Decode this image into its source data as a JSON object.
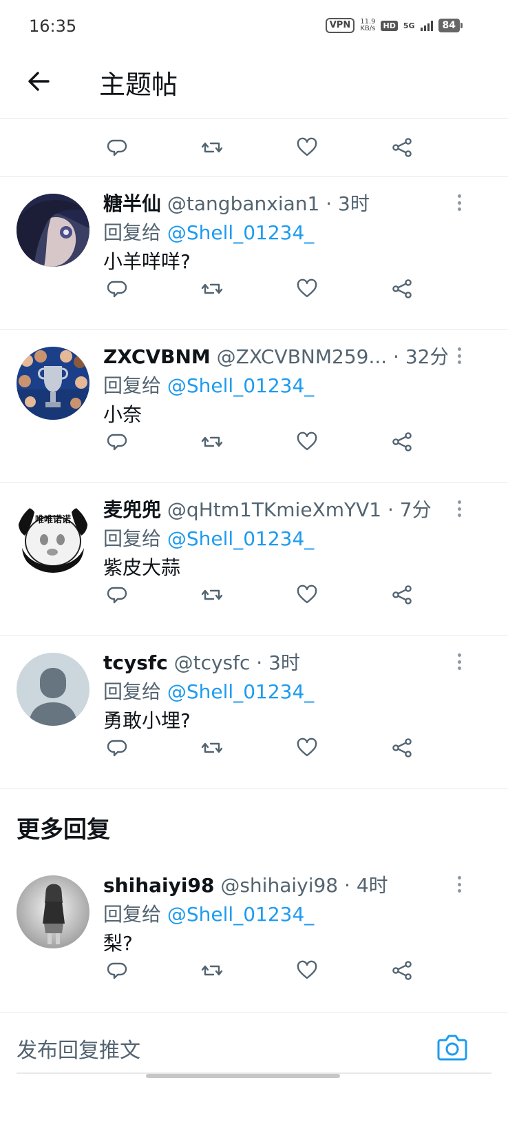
{
  "status_bar": {
    "time": "16:35",
    "vpn": "VPN",
    "speed_value": "11.9",
    "speed_unit": "KB/s",
    "hd": "HD",
    "network": "5G",
    "battery": "84"
  },
  "header": {
    "title": "主题帖"
  },
  "replies": [
    {
      "display_name": "糖半仙",
      "handle": "@tangbanxian1",
      "time": " · 3时",
      "reply_prefix": "回复给 ",
      "reply_to": "@Shell_01234_",
      "text": "小羊咩咩?",
      "avatar": "anime-portrait-avatar"
    },
    {
      "display_name": "ZXCVBNM",
      "handle": "@ZXCVBNM259...",
      "time": " · 32分",
      "reply_prefix": "回复给 ",
      "reply_to": "@Shell_01234_",
      "text": "小奈",
      "avatar": "football-team-trophy-avatar"
    },
    {
      "display_name": "麦兜兜",
      "handle": "@qHtm1TKmieXmYV1",
      "time": " · 7分",
      "reply_prefix": "回复给 ",
      "reply_to": "@Shell_01234_",
      "text": "紫皮大蒜",
      "avatar": "panda-meme-avatar",
      "avatar_caption": "唯唯诺诺"
    },
    {
      "display_name": "tcysfc",
      "handle": "@tcysfc",
      "time": " · 3时",
      "reply_prefix": "回复给 ",
      "reply_to": "@Shell_01234_",
      "text": "勇敢小埋?",
      "avatar": "default-person-avatar"
    }
  ],
  "more_replies": {
    "title": "更多回复",
    "items": [
      {
        "display_name": "shihaiyi98",
        "handle": "@shihaiyi98",
        "time": " · 4时",
        "reply_prefix": "回复给 ",
        "reply_to": "@Shell_01234_",
        "text": "梨?",
        "avatar": "anime-girl-grayscale-avatar"
      }
    ]
  },
  "composer": {
    "placeholder": "发布回复推文"
  },
  "icons": {
    "back": "back-arrow-icon",
    "reply": "reply-icon",
    "retweet": "retweet-icon",
    "like": "like-icon",
    "share": "share-icon",
    "more": "more-icon",
    "camera": "camera-icon"
  },
  "colors": {
    "accent": "#1d9bf0",
    "secondary_text": "#536471",
    "icon": "#536471",
    "divider": "#e6e9eb"
  }
}
